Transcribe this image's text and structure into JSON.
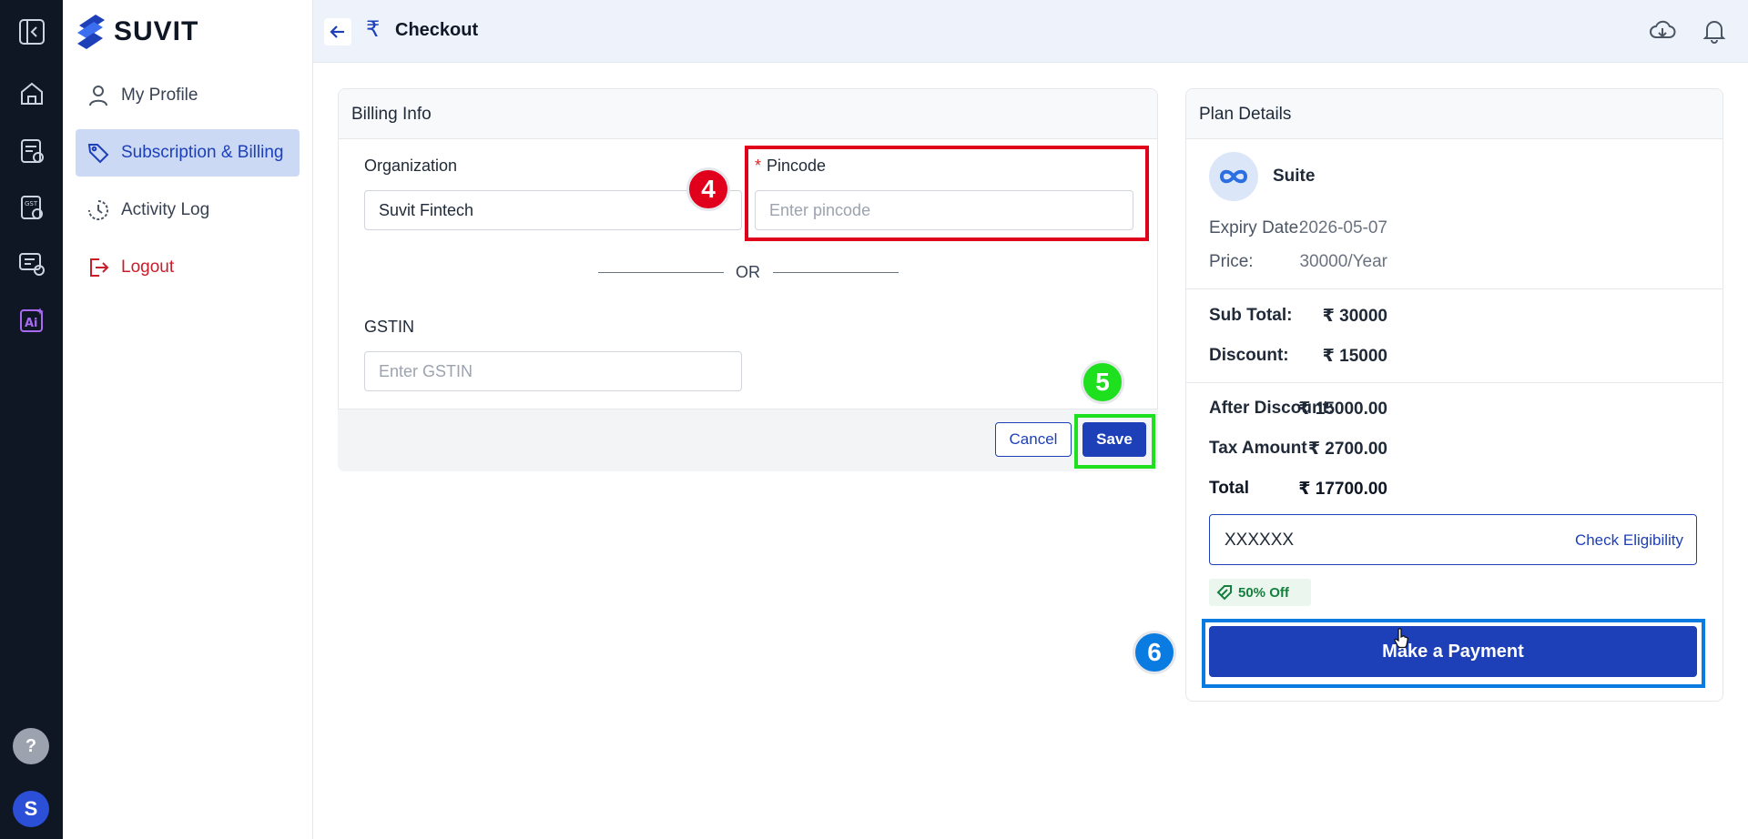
{
  "brand": {
    "name": "SUVIT"
  },
  "sidebar": {
    "items": [
      {
        "label": "My Profile",
        "icon": "user-icon"
      },
      {
        "label": "Subscription & Billing",
        "icon": "tag-icon",
        "active": true
      },
      {
        "label": "Activity Log",
        "icon": "history-icon"
      },
      {
        "label": "Logout",
        "icon": "logout-icon"
      }
    ]
  },
  "rail": {
    "icons": [
      "collapse-icon",
      "home-icon",
      "report-icon",
      "gst-settings-icon",
      "message-clock-icon",
      "ai-icon"
    ],
    "help_label": "?",
    "avatar_initial": "S"
  },
  "header": {
    "title": "Checkout",
    "icons": [
      "cloud-download-icon",
      "bell-icon"
    ]
  },
  "billing": {
    "title": "Billing Info",
    "organization_label": "Organization",
    "organization_value": "Suvit Fintech",
    "pincode_required_mark": "*",
    "pincode_label": "Pincode",
    "pincode_placeholder": "Enter pincode",
    "or_text": "OR",
    "gstin_label": "GSTIN",
    "gstin_placeholder": "Enter GSTIN",
    "cancel_label": "Cancel",
    "save_label": "Save"
  },
  "plan": {
    "title": "Plan Details",
    "name": "Suite",
    "expiry_label": "Expiry Date:",
    "expiry_value": "2026-05-07",
    "price_label": "Price:",
    "price_value": "30000/Year",
    "subtotal_label": "Sub Total:",
    "subtotal_value": "₹ 30000",
    "discount_label": "Discount:",
    "discount_value": "₹ 15000",
    "after_discount_label": "After Discount:",
    "after_discount_value": "₹ 15000.00",
    "tax_label": "Tax Amount",
    "tax_value": "₹ 2700.00",
    "total_label": "Total",
    "total_value": "₹ 17700.00",
    "coupon_value": "XXXXXX",
    "check_label": "Check Eligibility",
    "discount_badge": "50% Off",
    "pay_label": "Make a Payment"
  },
  "annotations": {
    "step_4": "4",
    "step_5": "5",
    "step_6": "6",
    "colors": {
      "step_4": "#e0001b",
      "step_5": "#1fe01f",
      "step_6": "#0a7be0"
    }
  }
}
